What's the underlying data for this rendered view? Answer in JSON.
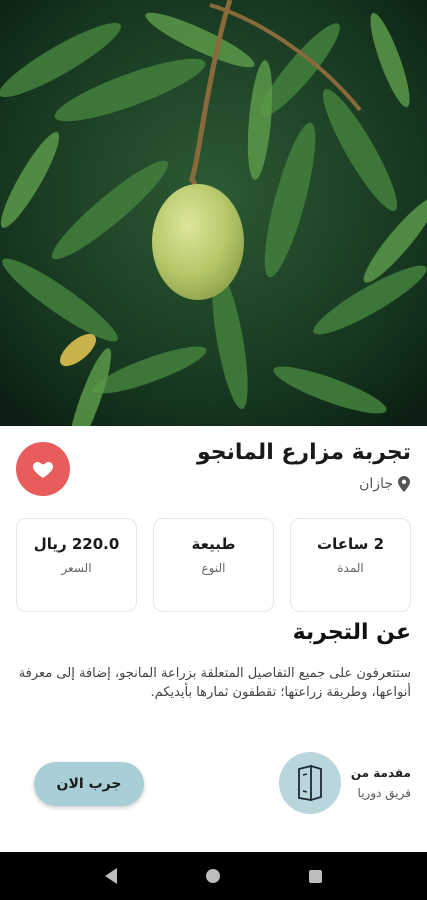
{
  "hero": {
    "image_subject": "mango on tree"
  },
  "experience": {
    "title": "تجربة مزارع المانجو",
    "location": "جازان"
  },
  "cards": [
    {
      "value": "2 ساعات",
      "label": "المدة"
    },
    {
      "value": "طبيعة",
      "label": "النوع"
    },
    {
      "value": "220.0 ريال",
      "label": "السعر"
    }
  ],
  "about": {
    "title": "عن التجربة",
    "text": "ستتعرفون على جميع التفاصيل المتعلقة بزراعة المانجو، إضافة إلى معرفة أنواعها، وطريقة زراعتها؛ تقطفون ثمارها بأيديكم."
  },
  "host": {
    "label": "مقدمة من",
    "name": "فريق دوريا"
  },
  "cta": {
    "label": "جرب الان"
  },
  "colors": {
    "favorite": "#e85c5c",
    "accent": "#a9cfd6",
    "avatar_bg": "#b9d6dc"
  },
  "icons": {
    "favorite": "heart-icon",
    "location": "location-pin-icon",
    "host": "door-icon"
  }
}
